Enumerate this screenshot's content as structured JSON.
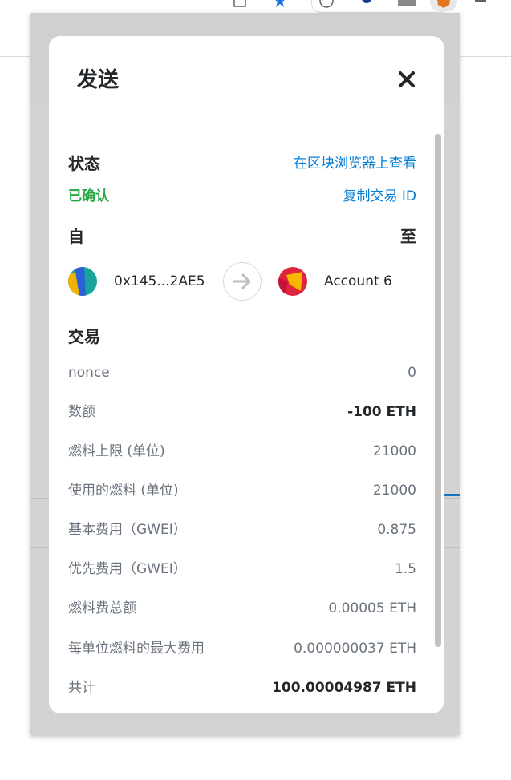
{
  "modal": {
    "title": "发送",
    "status_label": "状态",
    "view_on_explorer": "在区块浏览器上查看",
    "status_value": "已确认",
    "copy_tx_id": "复制交易 ID",
    "from_label": "自",
    "to_label": "至",
    "from_address": "0x145...2AE5",
    "to_account": "Account 6",
    "transaction_heading": "交易",
    "details": [
      {
        "label": "nonce",
        "value": "0",
        "bold": false
      },
      {
        "label": "数额",
        "value": "-100 ETH",
        "bold": true
      },
      {
        "label": "燃料上限 (单位)",
        "value": "21000",
        "bold": false
      },
      {
        "label": "使用的燃料 (单位)",
        "value": "21000",
        "bold": false
      },
      {
        "label": "基本费用（GWEI）",
        "value": "0.875",
        "bold": false
      },
      {
        "label": "优先费用（GWEI）",
        "value": "1.5",
        "bold": false
      },
      {
        "label": "燃料费总额",
        "value": "0.00005 ETH",
        "bold": false
      },
      {
        "label": "每单位燃料的最大费用",
        "value": "0.000000037 ETH",
        "bold": false
      },
      {
        "label": "共计",
        "value": "100.00004987 ETH",
        "bold": true
      }
    ]
  },
  "icons": {
    "close": "close-icon",
    "arrow": "arrow-right-icon"
  },
  "colors": {
    "link": "#037dd6",
    "confirmed": "#28a745",
    "text": "#24272a",
    "muted": "#6a737d"
  }
}
